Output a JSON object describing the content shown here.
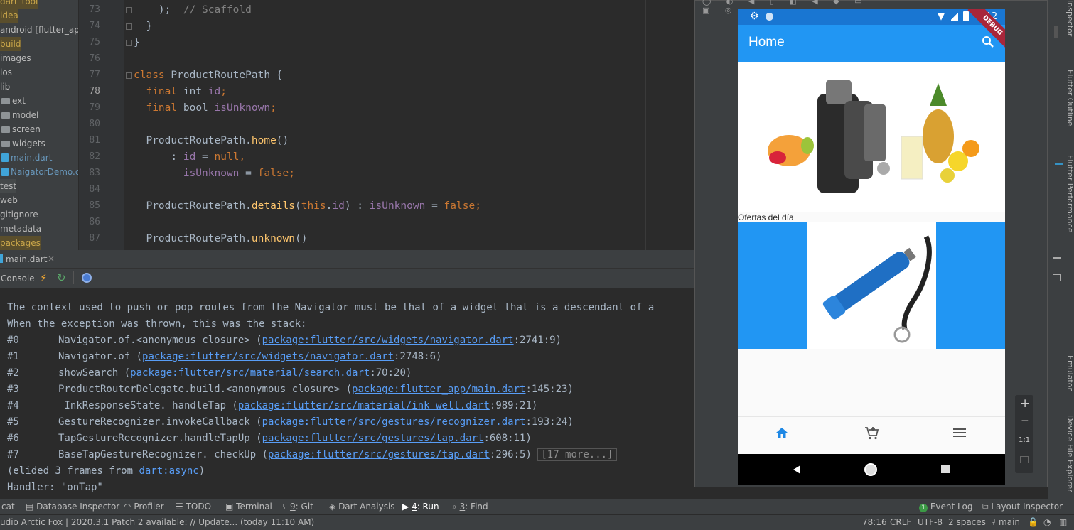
{
  "project_tree": {
    "items": [
      {
        "label": "dart_tool",
        "style": "orange"
      },
      {
        "label": "idea",
        "style": "orange"
      },
      {
        "label": "android [flutter_app_",
        "style": "normal"
      },
      {
        "label": "build",
        "style": "orange"
      },
      {
        "label": "images",
        "style": "normal"
      },
      {
        "label": "ios",
        "style": "normal"
      },
      {
        "label": "lib",
        "style": "normal"
      },
      {
        "label": "ext",
        "style": "folder"
      },
      {
        "label": "model",
        "style": "folder"
      },
      {
        "label": "screen",
        "style": "folder"
      },
      {
        "label": "widgets",
        "style": "folder"
      },
      {
        "label": "main.dart",
        "style": "dart"
      },
      {
        "label": "NaigatorDemo.dart",
        "style": "dart"
      },
      {
        "label": "test",
        "style": "gray"
      },
      {
        "label": "web",
        "style": "normal"
      },
      {
        "label": "gitignore",
        "style": "normal"
      },
      {
        "label": "metadata",
        "style": "normal"
      },
      {
        "label": "packages",
        "style": "orange"
      }
    ]
  },
  "editor": {
    "line_numbers": [
      "73",
      "74",
      "75",
      "76",
      "77",
      "78",
      "79",
      "80",
      "81",
      "82",
      "83",
      "84",
      "85",
      "86",
      "87"
    ],
    "current_line": "78"
  },
  "run_window": {
    "file_tab": "main.dart",
    "console_tab": "Console",
    "console": {
      "line1": "The context used to push or pop routes from the Navigator must be that of a widget that is a descendant of a",
      "line2": "When the exception was thrown, this was the stack:",
      "frames": [
        {
          "num": "#0",
          "name": "Navigator.of.<anonymous closure> (",
          "link": "package:flutter/src/widgets/navigator.dart",
          "pos": ":2741:9)"
        },
        {
          "num": "#1",
          "name": "Navigator.of (",
          "link": "package:flutter/src/widgets/navigator.dart",
          "pos": ":2748:6)"
        },
        {
          "num": "#2",
          "name": "showSearch (",
          "link": "package:flutter/src/material/search.dart",
          "pos": ":70:20)"
        },
        {
          "num": "#3",
          "name": "ProductRouterDelegate.build.<anonymous closure> (",
          "link": "package:flutter_app/main.dart",
          "pos": ":145:23)"
        },
        {
          "num": "#4",
          "name": "_InkResponseState._handleTap (",
          "link": "package:flutter/src/material/ink_well.dart",
          "pos": ":989:21)"
        },
        {
          "num": "#5",
          "name": "GestureRecognizer.invokeCallback (",
          "link": "package:flutter/src/gestures/recognizer.dart",
          "pos": ":193:24)"
        },
        {
          "num": "#6",
          "name": "TapGestureRecognizer.handleTapUp (",
          "link": "package:flutter/src/gestures/tap.dart",
          "pos": ":608:11)"
        },
        {
          "num": "#7",
          "name": "BaseTapGestureRecognizer._checkUp (",
          "link": "package:flutter/src/gestures/tap.dart",
          "pos": ":296:5)"
        }
      ],
      "more_frames": "[17 more...]",
      "elided_prefix": "(elided 3 frames from ",
      "elided_link": "dart:async",
      "elided_suffix": ")",
      "handler": "Handler: \"onTap\""
    }
  },
  "emulator": {
    "time": "5:12",
    "debug_banner": "DEBUG",
    "app_title": "Home",
    "section_label": "Ofertas del día",
    "zoom_in": "+",
    "zoom_out": "−",
    "zoom_reset": "1:1"
  },
  "right_strip": {
    "labels": [
      "Inspector",
      "Flutter Outline",
      "Flutter Performance",
      "Emulator",
      "Device File Explorer"
    ]
  },
  "bottom_toolbar": {
    "logcat": "cat",
    "database_inspector": "Database Inspector",
    "profiler": "Profiler",
    "todo": "TODO",
    "terminal": "Terminal",
    "git_num": "9",
    "git": ": Git",
    "dart_analysis": "Dart Analysis",
    "run_num": "4",
    "run": ": Run",
    "find_num": "3",
    "find": ": Find",
    "event_log": "Event Log",
    "event_log_count": "1",
    "layout_inspector": "Layout Inspector"
  },
  "status_bar": {
    "message": "udio Arctic Fox | 2020.3.1 Patch 2 available: // Update... (today 11:10 AM)",
    "position": "78:16",
    "line_sep": "CRLF",
    "encoding": "UTF-8",
    "indent": "2 spaces",
    "branch": "main"
  },
  "colors": {
    "accent": "#2196f3",
    "link": "#589df6",
    "keyword": "#cc7832",
    "function": "#ffc66d",
    "field": "#9876aa"
  }
}
